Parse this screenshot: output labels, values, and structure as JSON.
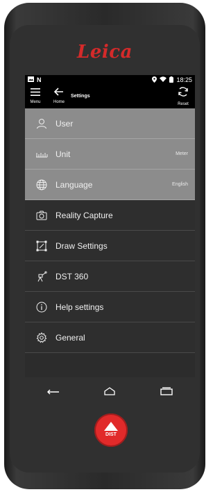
{
  "brand": {
    "logo": "Leica"
  },
  "status_bar": {
    "time": "18:25"
  },
  "app_bar": {
    "menu_label": "Menu",
    "home_label": "Home",
    "title": "Settings",
    "reset_label": "Reset"
  },
  "settings_items": [
    {
      "label": "User",
      "value": "",
      "icon": "user-icon"
    },
    {
      "label": "Unit",
      "value": "Meter",
      "icon": "ruler-icon"
    },
    {
      "label": "Language",
      "value": "English",
      "icon": "globe-icon"
    },
    {
      "label": "Reality Capture",
      "value": "",
      "icon": "camera-icon"
    },
    {
      "label": "Draw Settings",
      "value": "",
      "icon": "draw-icon"
    },
    {
      "label": "DST 360",
      "value": "",
      "icon": "dst360-icon"
    },
    {
      "label": "Help settings",
      "value": "",
      "icon": "info-icon"
    },
    {
      "label": "General",
      "value": "",
      "icon": "gear-icon"
    }
  ],
  "device_button": {
    "label": "DIST"
  },
  "colors": {
    "accent": "#e12a2a",
    "highlighted_row": "#8c8c8c",
    "dark_row": "#2e2e2e"
  }
}
